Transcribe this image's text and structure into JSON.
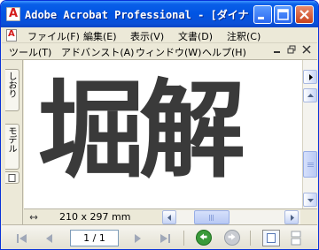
{
  "window": {
    "title": "Adobe Acrobat Professional - [ダイナフ…",
    "app_icon_letter": "A"
  },
  "menubar": {
    "doc_icon_letter": "A",
    "row1": [
      "ファイル(F)",
      "編集(E)",
      "表示(V)",
      "文書(D)",
      "注釈(C)"
    ],
    "row2": [
      "ツール(T)",
      "アドバンスト(A)",
      "ウィンドウ(W)",
      "ヘルプ(H)"
    ]
  },
  "navpane": {
    "tabs": [
      "しおり",
      "モデル"
    ]
  },
  "document": {
    "content_text": "堀解"
  },
  "statusbar": {
    "page_size": "210 x 297 mm",
    "page_indicator": "1 / 1"
  },
  "colors": {
    "titlebar": "#0054e3",
    "glyph_text": "#3a3a3a",
    "back_button": "#3a9a3a"
  }
}
